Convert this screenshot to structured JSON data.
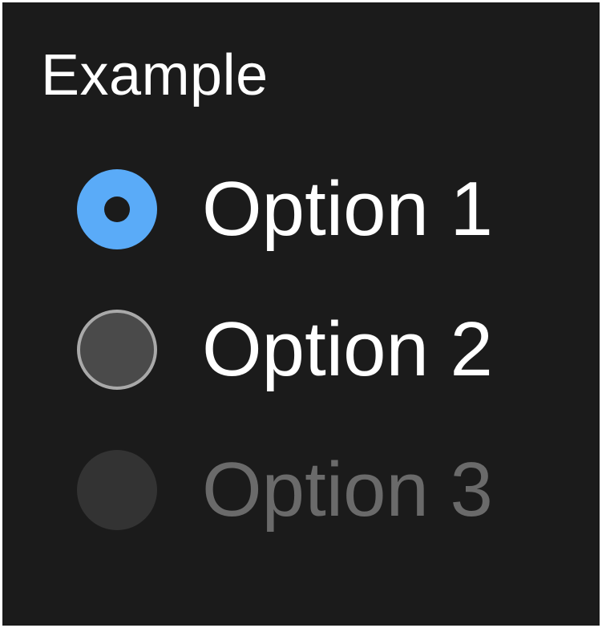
{
  "group": {
    "title": "Example"
  },
  "options": [
    {
      "label": "Option 1",
      "state": "selected"
    },
    {
      "label": "Option 2",
      "state": "unselected"
    },
    {
      "label": "Option 3",
      "state": "disabled"
    }
  ],
  "colors": {
    "background": "#1b1b1b",
    "accent": "#5aabf8",
    "text": "#ffffff",
    "disabled_text": "#6a6a6a"
  },
  "icons": {
    "selected": "radio-selected-icon",
    "unselected": "radio-unselected-icon",
    "disabled": "radio-disabled-icon"
  }
}
